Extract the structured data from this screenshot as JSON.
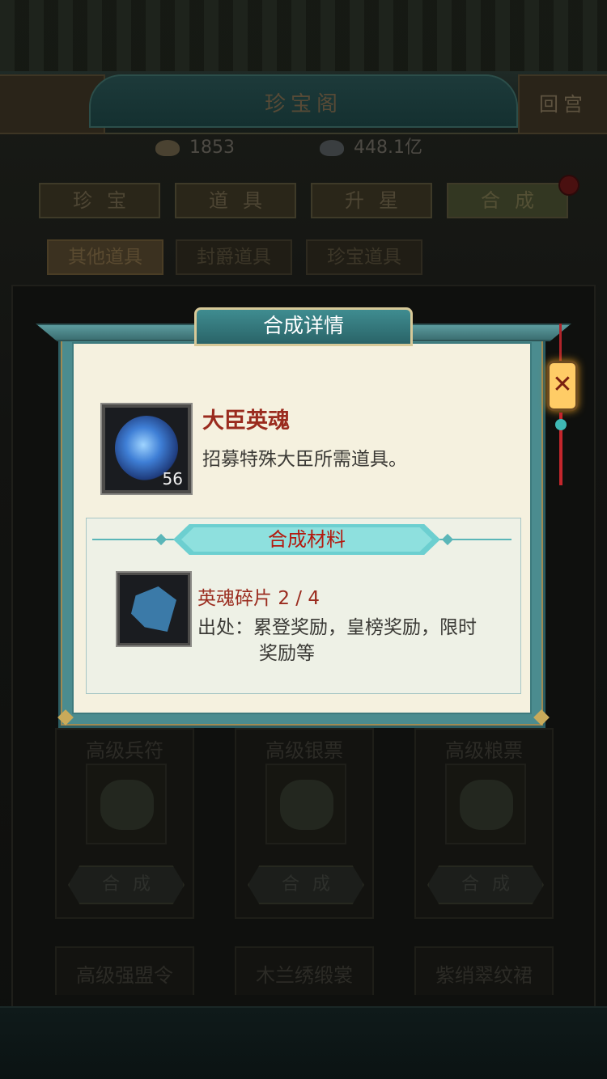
{
  "header": {
    "title": "珍宝阁",
    "back_label": "回宫"
  },
  "resources": {
    "gold": "1853",
    "silver": "448.1亿"
  },
  "tabs": [
    {
      "label": "珍宝"
    },
    {
      "label": "道具"
    },
    {
      "label": "升星"
    },
    {
      "label": "合成"
    }
  ],
  "subtabs": [
    {
      "label": "其他道具"
    },
    {
      "label": "封爵道具"
    },
    {
      "label": "珍宝道具"
    }
  ],
  "cards": [
    {
      "name": "高级兵符",
      "button": "合成"
    },
    {
      "name": "高级银票",
      "button": "合成"
    },
    {
      "name": "高级粮票",
      "button": "合成"
    }
  ],
  "cards_row2": [
    {
      "name": "高级强盟令"
    },
    {
      "name": "木兰绣缎裳"
    },
    {
      "name": "紫绡翠纹裙"
    }
  ],
  "modal": {
    "title": "合成详情",
    "item": {
      "name": "大臣英魂",
      "count": "56",
      "description": "招募特殊大臣所需道具。",
      "icon": "blue-soul-icon"
    },
    "materials_title": "合成材料",
    "material": {
      "name": "英魂碎片",
      "progress": "2 / 4",
      "source_label": "出处：",
      "source_line1": "累登奖励，皇榜奖励，限时",
      "source_line2": "奖励等",
      "icon": "soul-shard-icon"
    }
  },
  "colors": {
    "modal_teal": "#4b8c8f",
    "parchment": "#f5f1df",
    "name_red": "#9a2b1e",
    "banner_cyan": "#6ccfd0"
  }
}
